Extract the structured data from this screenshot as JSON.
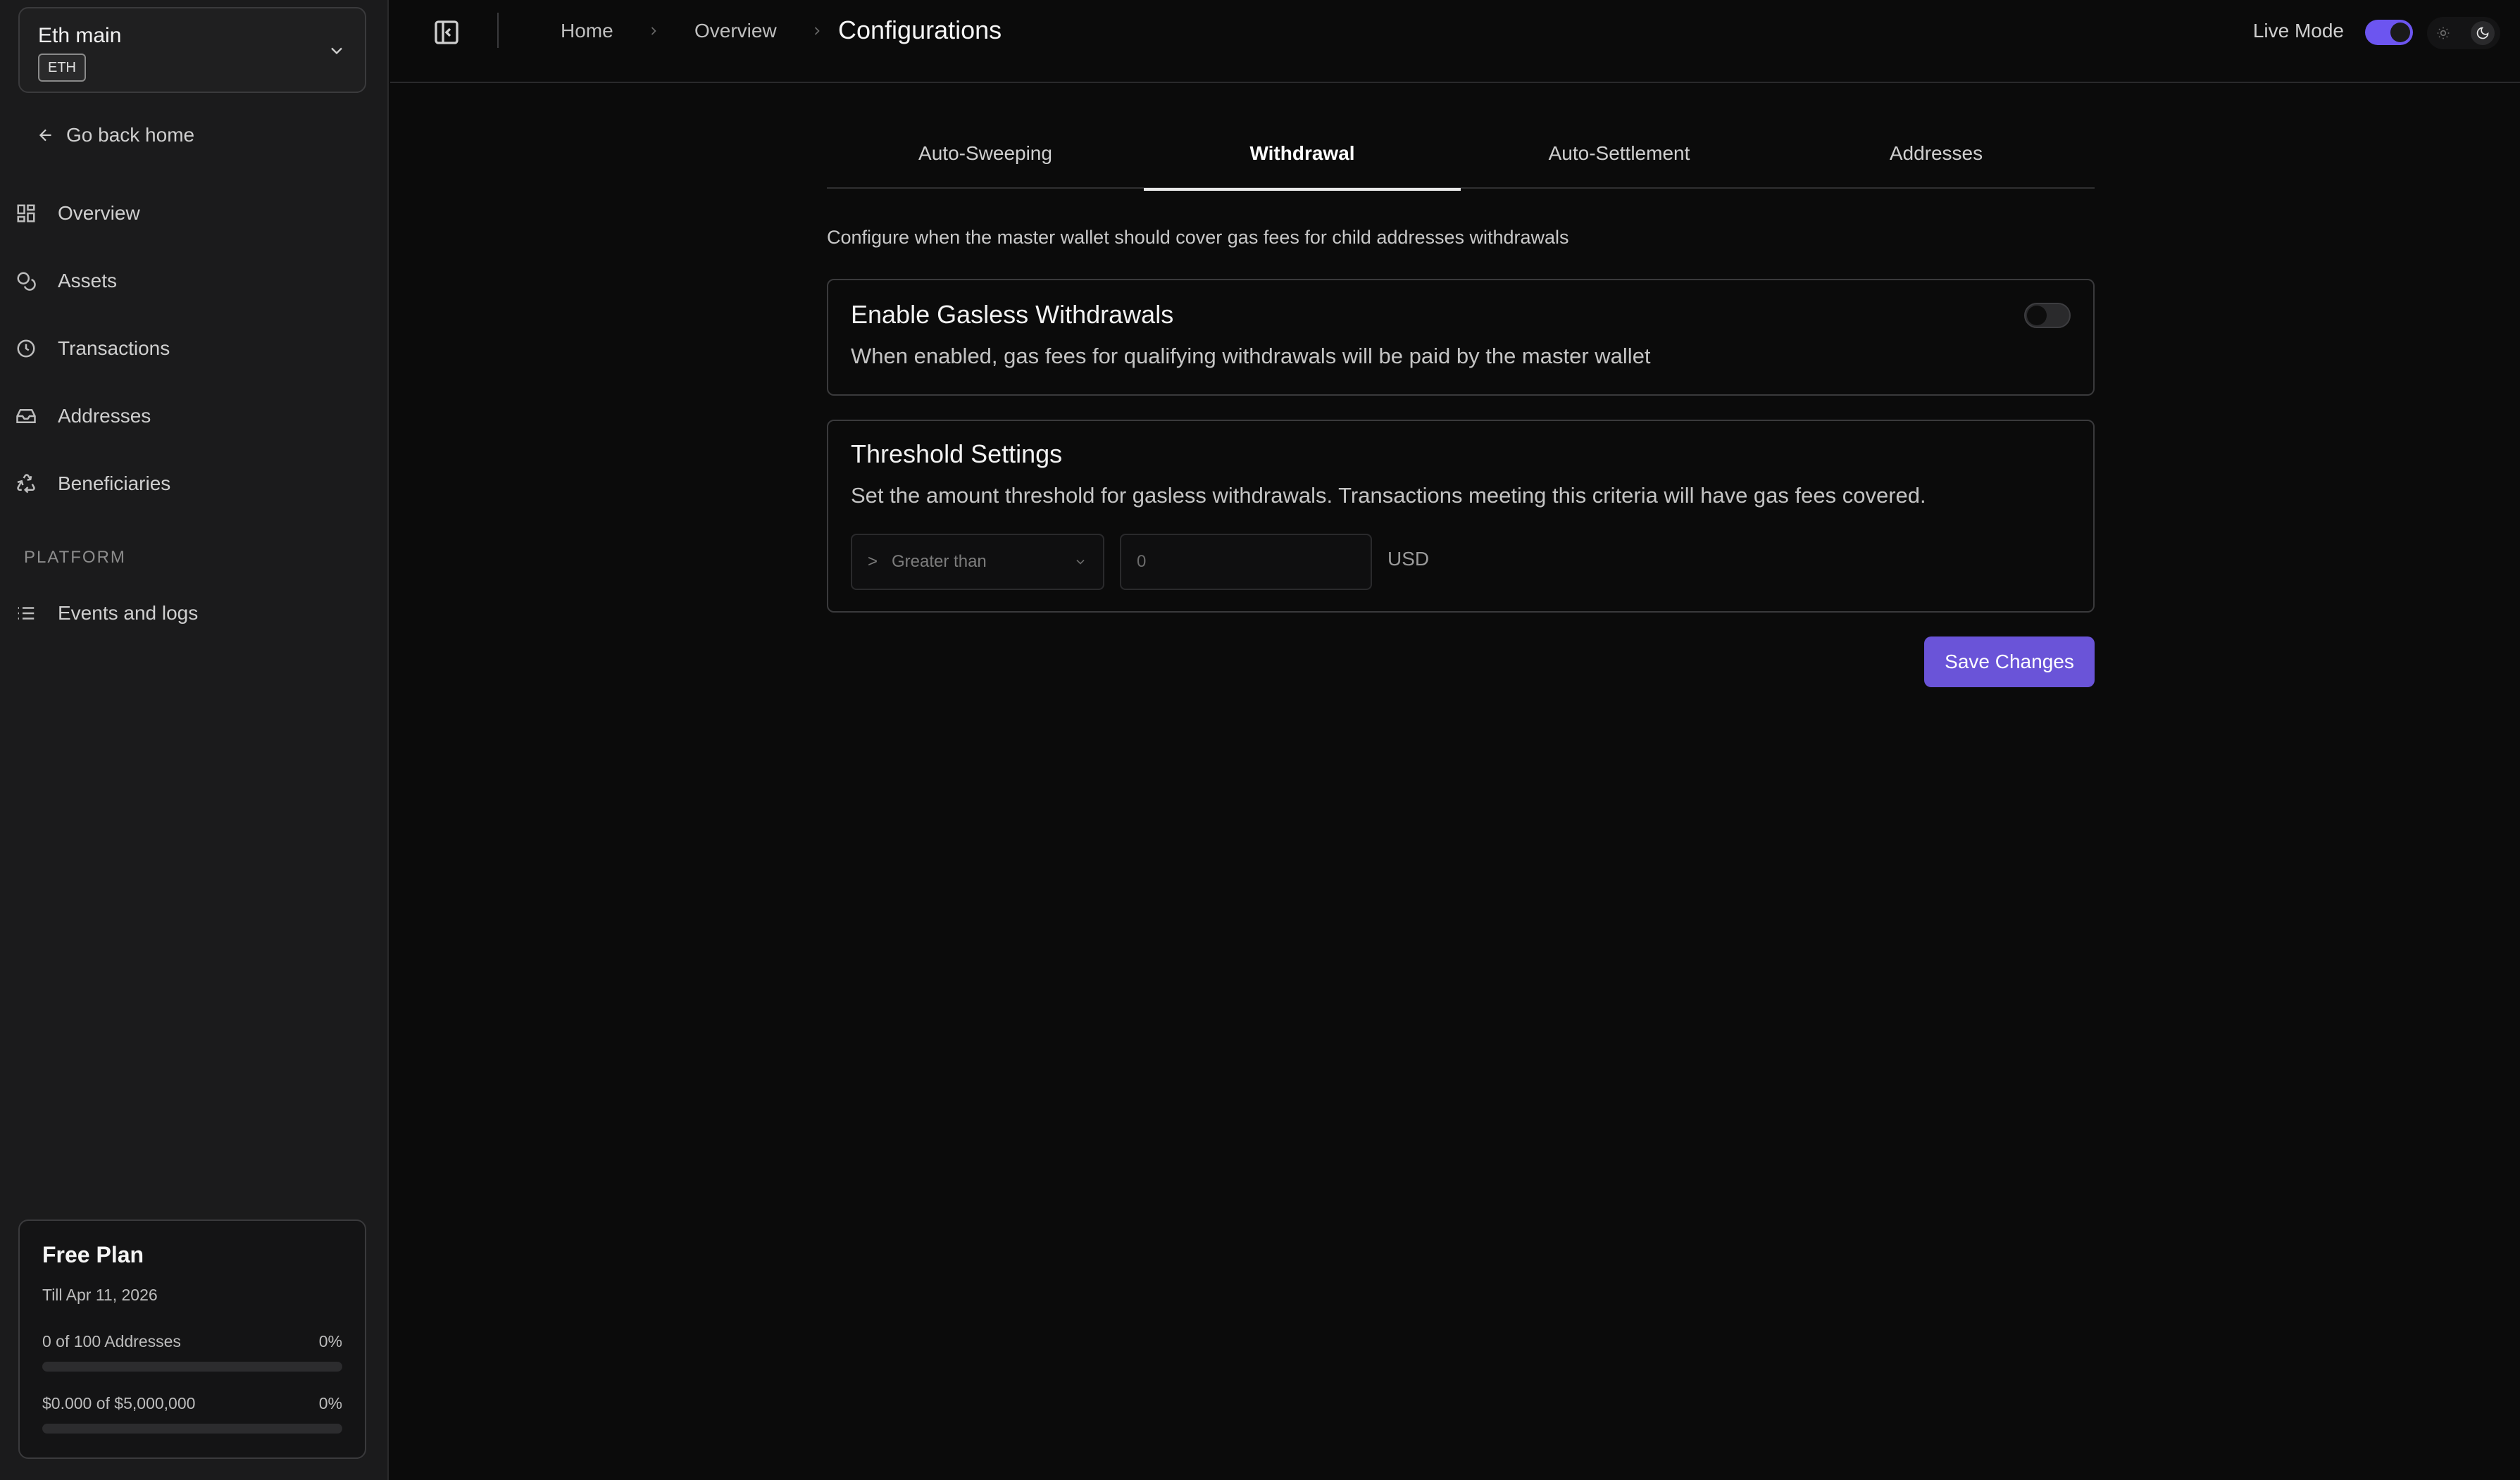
{
  "wallet": {
    "name": "Eth main",
    "chip": "ETH"
  },
  "sidebar": {
    "back_home": "Go back home",
    "items": [
      {
        "label": "Overview",
        "icon": "grid-icon"
      },
      {
        "label": "Assets",
        "icon": "coins-icon"
      },
      {
        "label": "Transactions",
        "icon": "clock-icon"
      },
      {
        "label": "Addresses",
        "icon": "inbox-icon"
      },
      {
        "label": "Beneficiaries",
        "icon": "recycle-icon"
      }
    ],
    "section_platform": "PLATFORM",
    "platform_items": [
      {
        "label": "Events and logs",
        "icon": "list-icon"
      }
    ]
  },
  "plan": {
    "title": "Free Plan",
    "subtitle": "Till Apr 11, 2026",
    "addresses_text": "0 of 100 Addresses",
    "addresses_percent": "0%",
    "addresses_fraction": 0,
    "volume_text": "$0.000 of $5,000,000",
    "volume_percent": "0%",
    "volume_fraction": 0
  },
  "header": {
    "breadcrumbs": [
      "Home",
      "Overview"
    ],
    "current": "Configurations",
    "live_mode_label": "Live Mode",
    "live_mode_on": true
  },
  "tabs": [
    {
      "label": "Auto-Sweeping",
      "active": false
    },
    {
      "label": "Withdrawal",
      "active": true
    },
    {
      "label": "Auto-Settlement",
      "active": false
    },
    {
      "label": "Addresses",
      "active": false
    }
  ],
  "main": {
    "description": "Configure when the master wallet should cover gas fees for child addresses withdrawals",
    "gasless": {
      "title": "Enable Gasless Withdrawals",
      "text": "When enabled, gas fees for qualifying withdrawals will be paid by the master wallet",
      "enabled": false
    },
    "threshold": {
      "title": "Threshold Settings",
      "text": "Set the amount threshold for gasless withdrawals. Transactions meeting this criteria will have gas fees covered.",
      "operator_symbol": ">",
      "operator_label": "Greater than",
      "amount_placeholder": "0",
      "unit": "USD"
    },
    "save_label": "Save Changes"
  },
  "colors": {
    "accent": "#6c55f0",
    "background": "#0b0b0b",
    "sidebar": "#1b1b1c"
  }
}
